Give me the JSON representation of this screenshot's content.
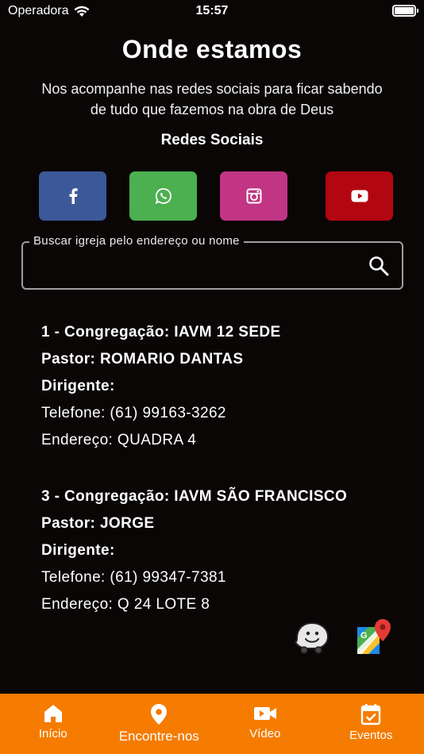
{
  "status_bar": {
    "carrier": "Operadora",
    "time": "15:57"
  },
  "header": {
    "title": "Onde estamos",
    "subtitle": "Nos acompanhe nas redes sociais para ficar sabendo de tudo que fazemos na obra de Deus",
    "social_title": "Redes Sociais"
  },
  "social": [
    {
      "name": "facebook",
      "color": "#3b5998",
      "icon": "facebook-icon"
    },
    {
      "name": "whatsapp",
      "color": "#4caf50",
      "icon": "whatsapp-icon"
    },
    {
      "name": "instagram",
      "color": "#c13584",
      "icon": "instagram-icon"
    },
    {
      "name": "youtube",
      "color": "#b20710",
      "icon": "youtube-icon"
    }
  ],
  "search": {
    "label": "Buscar igreja pelo endereço ou nome",
    "value": ""
  },
  "churches": [
    {
      "congregacao": "1 - Congregação: IAVM 12 SEDE",
      "pastor": "Pastor: ROMARIO DANTAS",
      "dirigente": "Dirigente:",
      "telefone": "Telefone: (61) 99163-3262",
      "endereco": "Endereço: QUADRA 4"
    },
    {
      "congregacao": "3 - Congregação: IAVM SÃO FRANCISCO",
      "pastor": "Pastor: JORGE",
      "dirigente": "Dirigente:",
      "telefone": "Telefone: (61) 99347-7381",
      "endereco": "Endereço: Q 24 LOTE 8"
    }
  ],
  "nav": {
    "items": [
      {
        "label": "Início",
        "icon": "home-icon"
      },
      {
        "label": "Encontre-nos",
        "icon": "location-pin-icon",
        "active": true
      },
      {
        "label": "Vídeo",
        "icon": "video-camera-icon"
      },
      {
        "label": "Eventos",
        "icon": "calendar-check-icon"
      }
    ],
    "color": "#f57c00"
  }
}
